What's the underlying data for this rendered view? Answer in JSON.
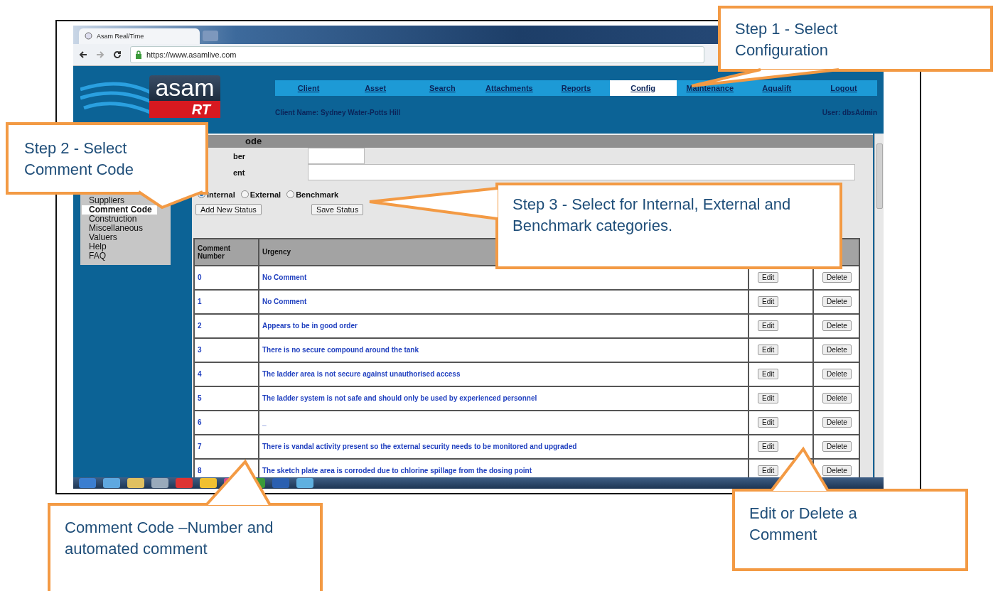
{
  "browser": {
    "tab_title": "Asam Real/Time",
    "url": "https://www.asamlive.com"
  },
  "logo": {
    "word": "asam",
    "badge": "RT"
  },
  "nav": [
    {
      "label": "Client",
      "selected": false
    },
    {
      "label": "Asset",
      "selected": false
    },
    {
      "label": "Search",
      "selected": false
    },
    {
      "label": "Attachments",
      "selected": false
    },
    {
      "label": "Reports",
      "selected": false
    },
    {
      "label": "Config",
      "selected": true
    },
    {
      "label": "Maintenance",
      "selected": false
    },
    {
      "label": "Aqualift",
      "selected": false
    },
    {
      "label": "Logout",
      "selected": false
    }
  ],
  "client_name": "Client Name: Sydney Water-Potts Hill",
  "user": "User: dbsAdmin",
  "sidebar": {
    "items": [
      {
        "label": "Suppliers",
        "selected": false
      },
      {
        "label": "Comment Code",
        "selected": true
      },
      {
        "label": "Construction",
        "selected": false
      },
      {
        "label": "Miscellaneous",
        "selected": false
      },
      {
        "label": "Valuers",
        "selected": false
      },
      {
        "label": "Help",
        "selected": false
      },
      {
        "label": "FAQ",
        "selected": false
      }
    ]
  },
  "panel": {
    "title": "ode",
    "fields": [
      {
        "label": "ber",
        "kind": "short"
      },
      {
        "label": "ent",
        "kind": "long"
      }
    ],
    "radios": [
      {
        "label": "Internal",
        "selected": true
      },
      {
        "label": "External",
        "selected": false
      },
      {
        "label": "Benchmark",
        "selected": false
      }
    ],
    "buttons": [
      "Add New Status",
      "Save Status"
    ]
  },
  "table": {
    "columns": [
      "Comment Number",
      "Urgency"
    ],
    "rows": [
      {
        "number": "0",
        "comment": "No Comment",
        "edit": "Edit",
        "delete": "Delete"
      },
      {
        "number": "1",
        "comment": "No Comment",
        "edit": "Edit",
        "delete": "Delete"
      },
      {
        "number": "2",
        "comment": "Appears to be in good order",
        "edit": "Edit",
        "delete": "Delete"
      },
      {
        "number": "3",
        "comment": "There is no secure compound around the tank",
        "edit": "Edit",
        "delete": "Delete"
      },
      {
        "number": "4",
        "comment": "The ladder area is not secure against unauthorised access",
        "edit": "Edit",
        "delete": "Delete"
      },
      {
        "number": "5",
        "comment": "The ladder system is not safe and should only be used by experienced personnel",
        "edit": "Edit",
        "delete": "Delete"
      },
      {
        "number": "6",
        "comment": "_",
        "edit": "Edit",
        "delete": "Delete"
      },
      {
        "number": "7",
        "comment": "There is vandal activity present so the external security needs to be monitored and upgraded",
        "edit": "Edit",
        "delete": "Delete"
      },
      {
        "number": "8",
        "comment": "The sketch plate area is corroded due to chlorine spillage from the dosing point",
        "edit": "Edit",
        "delete": "Delete"
      }
    ]
  },
  "callouts": [
    {
      "text": "Step 1 - Select Configuration"
    },
    {
      "text": "Step 2 - Select Comment Code"
    },
    {
      "text": "Step 3 - Select for Internal, External and Benchmark categories."
    },
    {
      "text": "Comment Code –Number and automated comment"
    },
    {
      "text": "Edit or Delete a Comment"
    }
  ]
}
